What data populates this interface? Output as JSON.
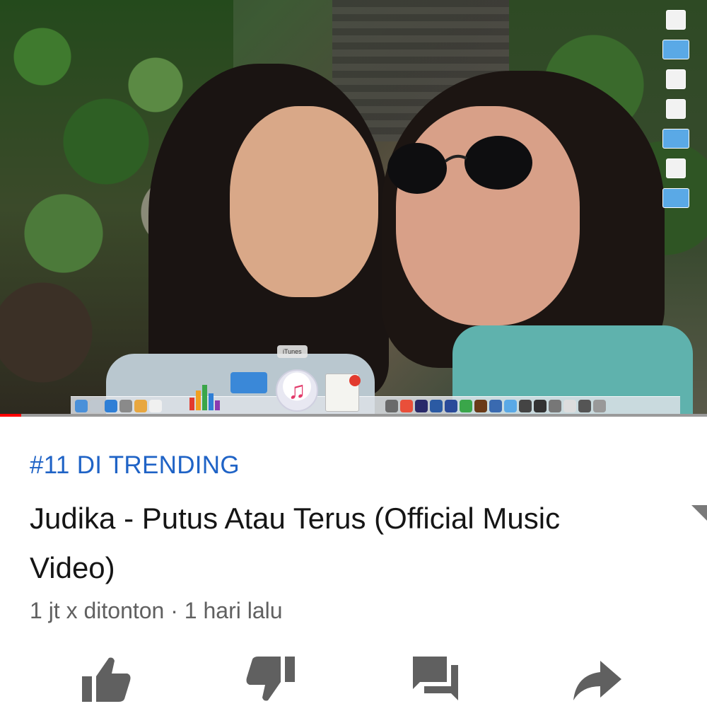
{
  "video": {
    "progress_fraction": 0.03,
    "tooltip_label": "iTunes",
    "colors": {
      "progress": "#ff0000",
      "trending": "#1f63c6"
    }
  },
  "info": {
    "trending_label": "#11 DI TRENDING",
    "title": "Judika - Putus Atau Terus (Official Music Video)",
    "meta": "1 jt x ditonton · 1 hari lalu"
  },
  "actions": [
    {
      "icon": "like-icon"
    },
    {
      "icon": "dislike-icon"
    },
    {
      "icon": "comment-icon"
    },
    {
      "icon": "share-icon"
    }
  ]
}
